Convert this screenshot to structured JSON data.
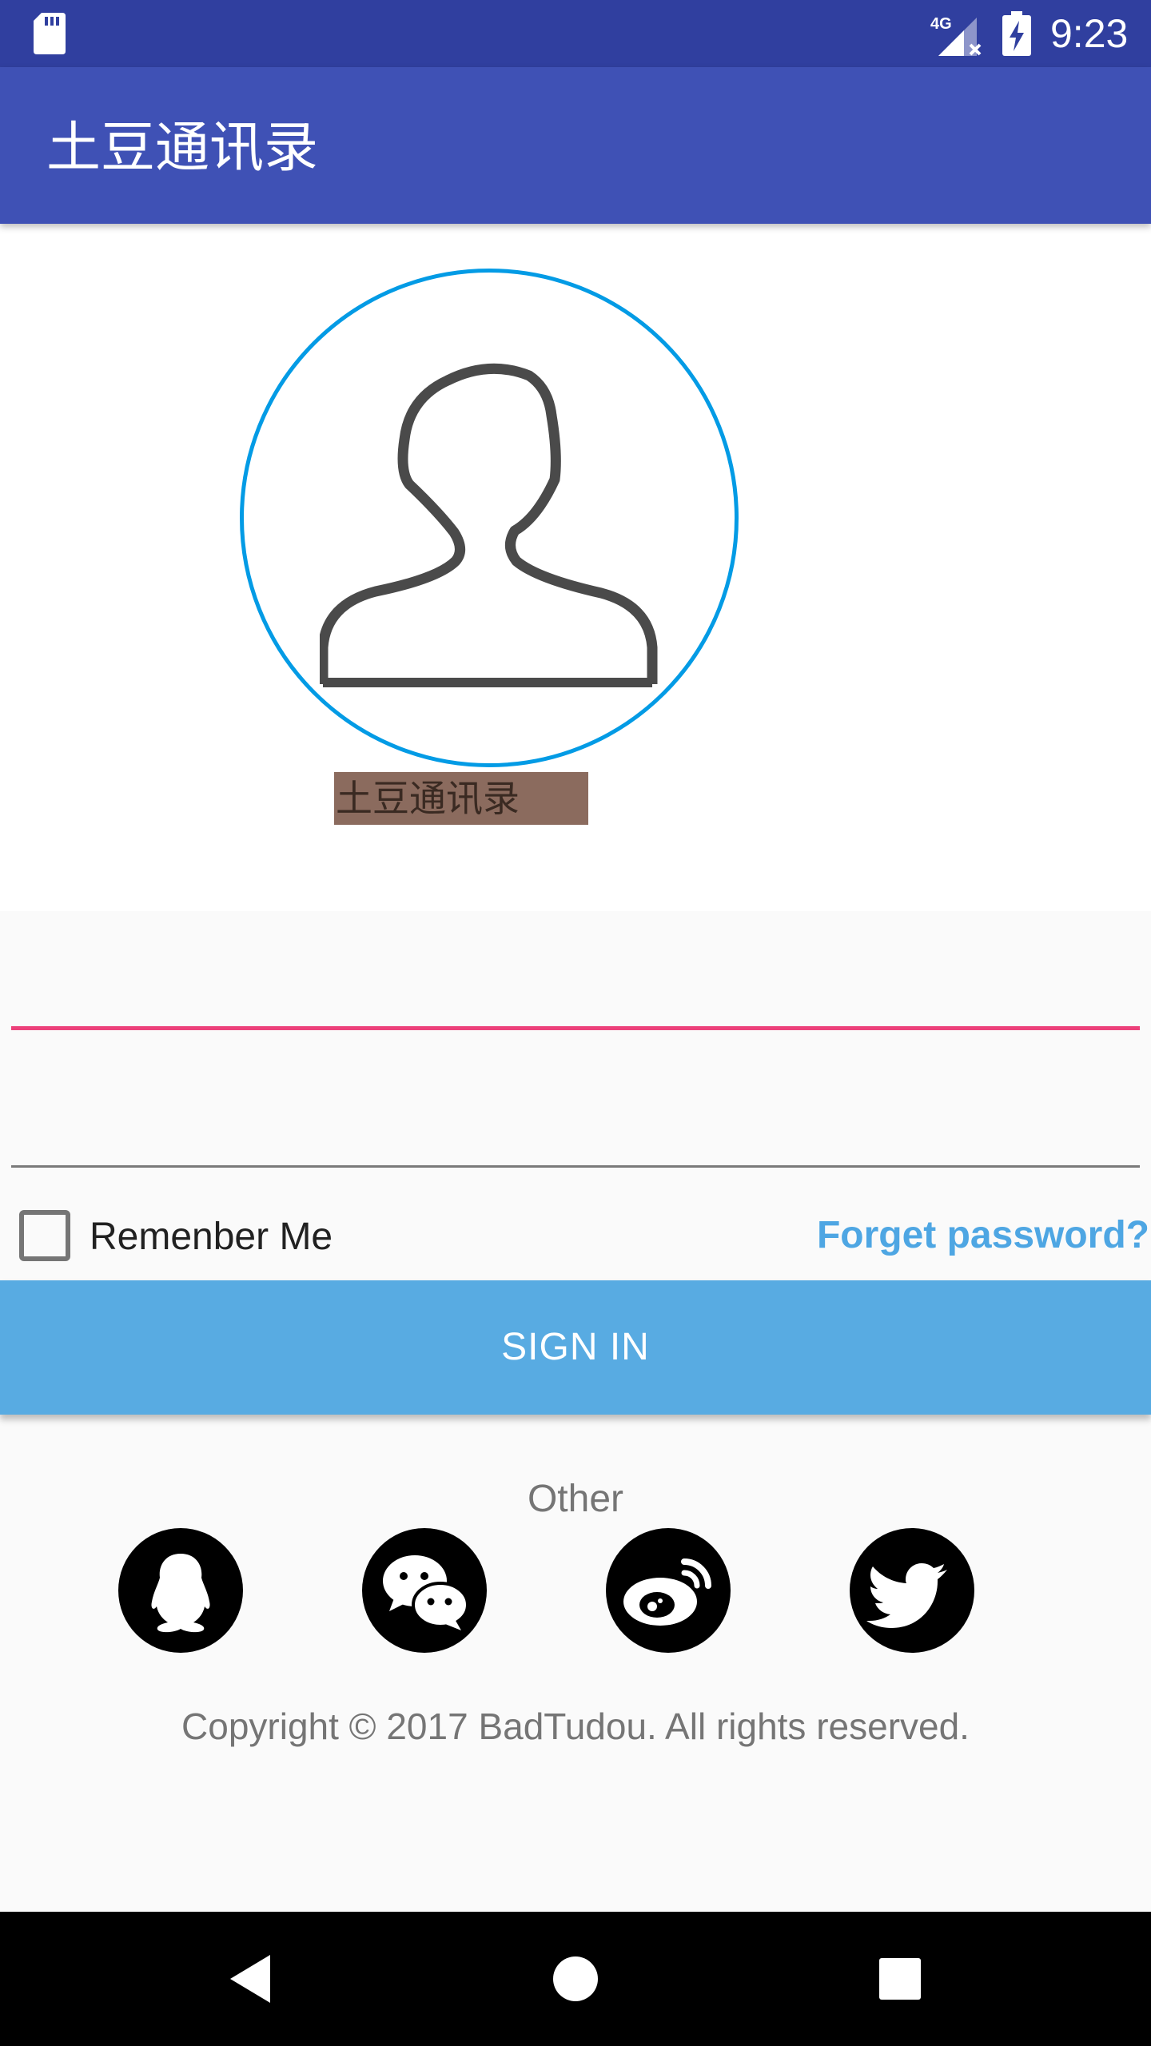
{
  "status_bar": {
    "time": "9:23",
    "network_label": "4G",
    "icons": [
      "sd-card-icon",
      "signal-4g-icon",
      "battery-charging-icon"
    ]
  },
  "app_bar": {
    "title": "土豆通讯录"
  },
  "profile": {
    "avatar_icon": "person-outline-icon",
    "label": "土豆通讯录"
  },
  "form": {
    "username_value": "",
    "password_value": "",
    "remember_label": "Remenber Me",
    "remember_checked": false,
    "forget_label": "Forget password?",
    "sign_in_label": "SIGN IN"
  },
  "social": {
    "heading": "Other",
    "items": [
      {
        "name": "qq",
        "icon": "qq-icon"
      },
      {
        "name": "wechat",
        "icon": "wechat-icon"
      },
      {
        "name": "weibo",
        "icon": "weibo-icon"
      },
      {
        "name": "twitter",
        "icon": "twitter-icon"
      }
    ]
  },
  "footer": {
    "copyright": "Copyright © 2017 BadTudou. All rights reserved."
  },
  "colors": {
    "status_bar": "#303f9f",
    "app_bar": "#3f51b5",
    "accent": "#ec407a",
    "sign_in": "#58abe2",
    "link": "#4ea6e3",
    "avatar_ring": "#039be5"
  }
}
